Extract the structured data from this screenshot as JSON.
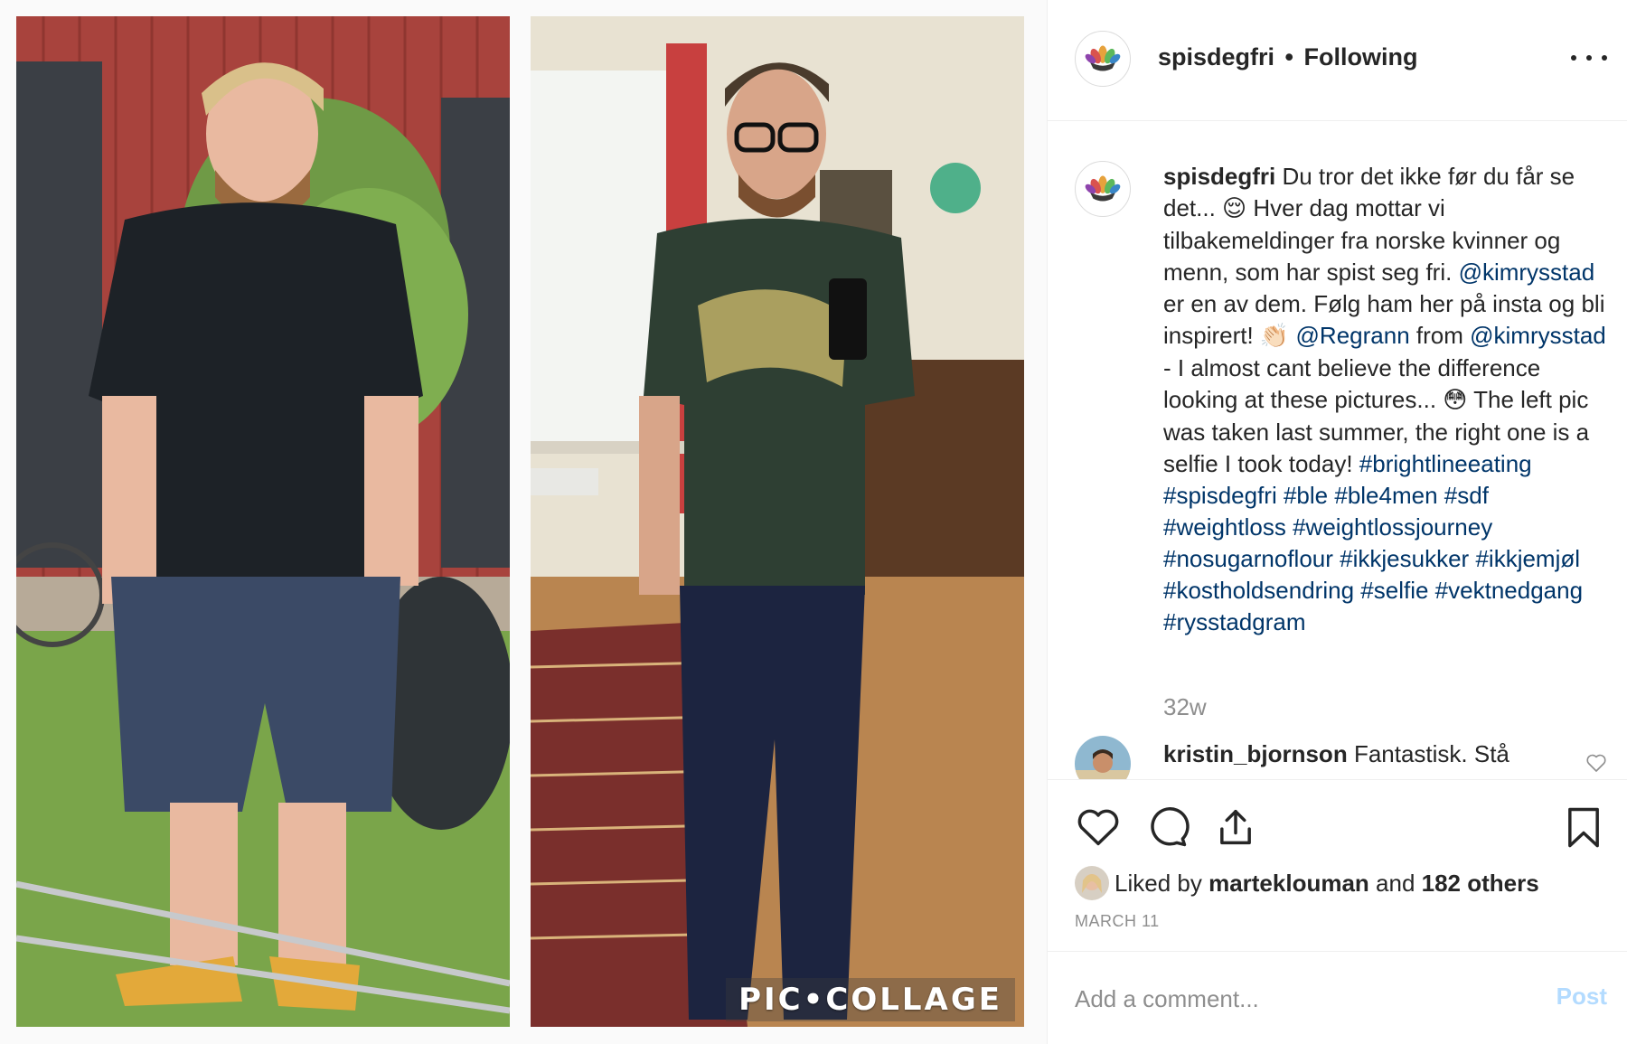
{
  "post": {
    "username": "spisdegfri",
    "separator": "•",
    "follow_status": "Following",
    "watermark": "PIC•COLLAGE"
  },
  "caption": {
    "username": "spisdegfri",
    "p1": " Du tror det ikke før du får se det... ",
    "emoji1": "😌",
    "p2": "  Hver dag mottar vi tilbakemeldinger fra norske kvinner og menn, som har spist seg fri. ",
    "mention1": "@kimrysstad",
    "p3": " er en av dem. Følg ham her på insta og bli inspirert! ",
    "emoji2": "👏🏻",
    "mention2": "@Regrann",
    "p4": " from ",
    "mention3": "@kimrysstad",
    "p5": " - I almost cant believe the difference looking at these pictures... ",
    "emoji3": "😳",
    "p6": "  The left pic was taken last summer, the right one is a selfie I took today! ",
    "hashtags": [
      "#brightlineeating",
      "#spisdegfri",
      "#ble",
      "#ble4men",
      "#sdf",
      "#weightloss",
      "#weightlossjourney",
      "#nosugarnoflour",
      "#ikkjesukker",
      "#ikkjemjøl",
      "#kostholdsendring",
      "#selfie",
      "#vektnedgang",
      "#rysstadgram"
    ],
    "time_ago": "32w"
  },
  "comment": {
    "username": "kristin_bjornson",
    "text": "Fantastisk. Stå"
  },
  "likes": {
    "prefix": "Liked by ",
    "user": "marteklouman",
    "middle": " and ",
    "others": "182 others"
  },
  "date": "MARCH 11",
  "add_comment": {
    "placeholder": "Add a comment...",
    "post_label": "Post"
  },
  "icons": {
    "like": "heart-icon",
    "comment": "comment-bubble-icon",
    "share": "share-icon",
    "save": "bookmark-icon",
    "more": "more-options-icon"
  },
  "colors": {
    "link": "#003569",
    "muted": "#8e8e8e",
    "post_button_disabled": "#b3dbff"
  }
}
